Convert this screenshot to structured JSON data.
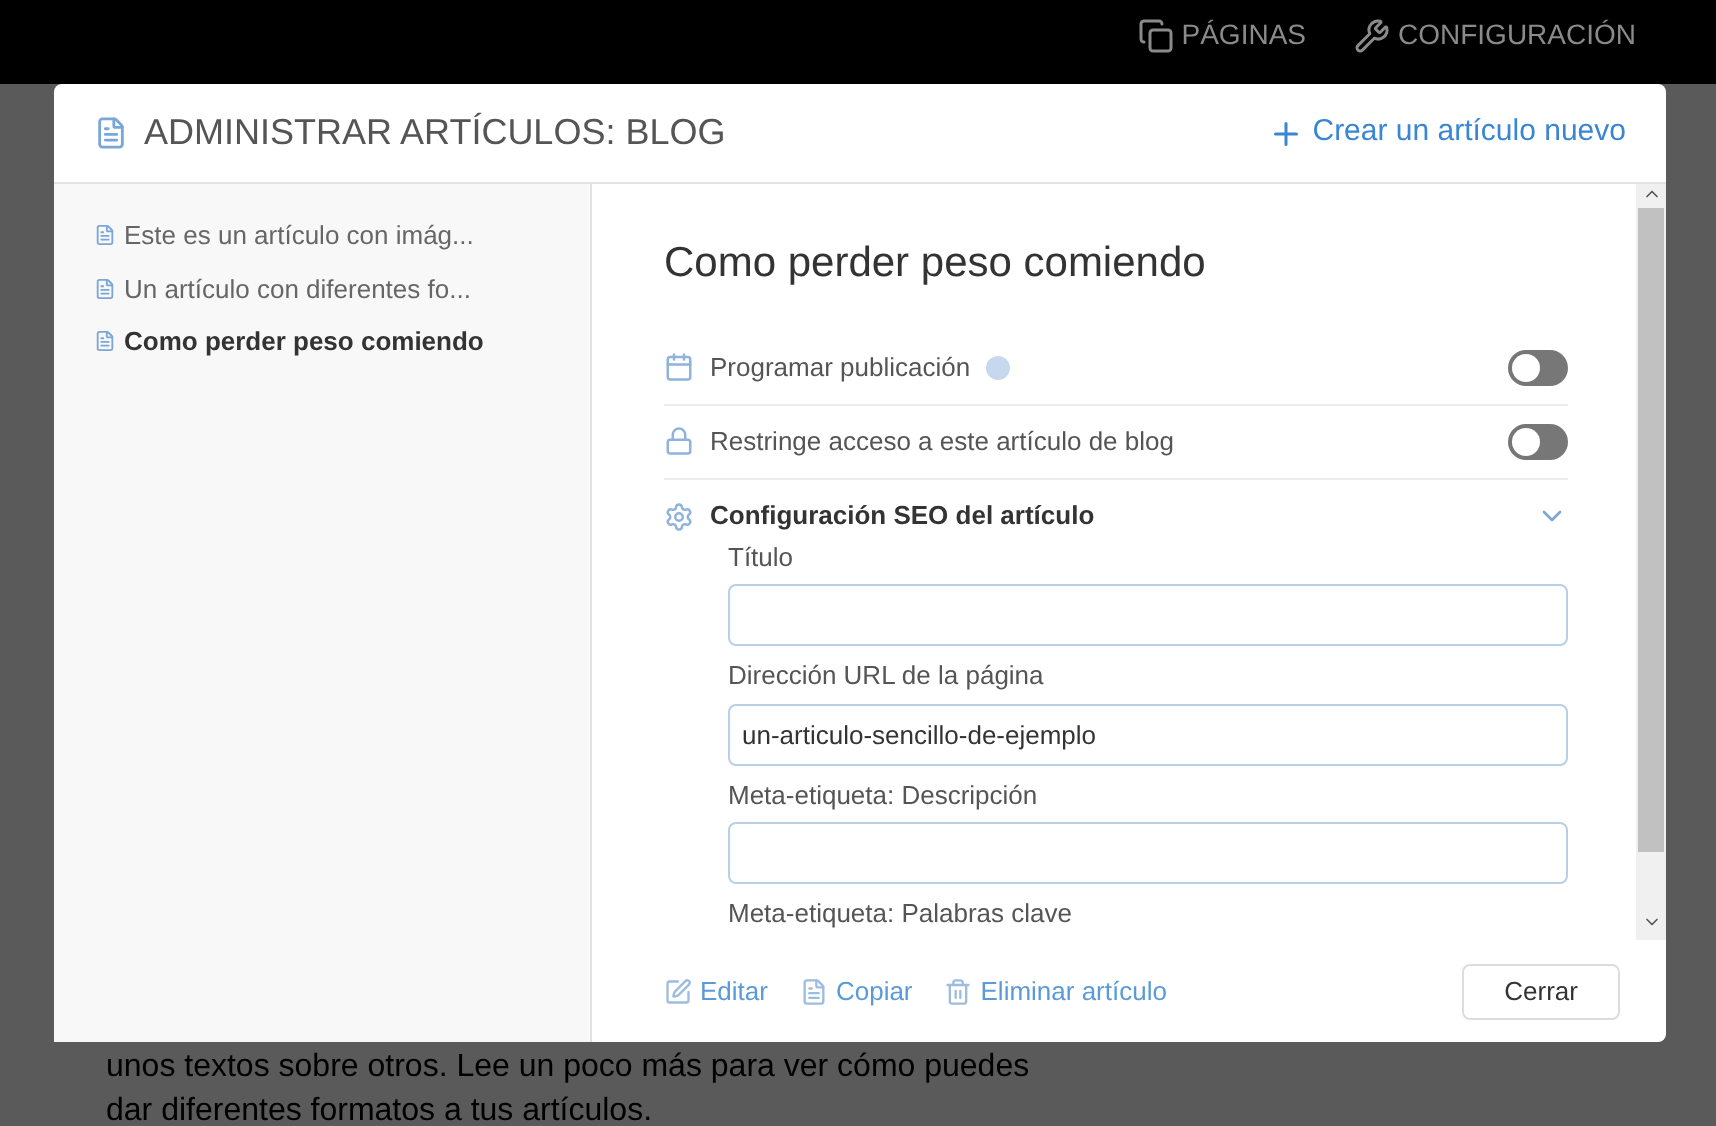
{
  "top_nav": [
    {
      "kind": "pages",
      "label": "PÁGINAS"
    },
    {
      "kind": "settings",
      "label": "CONFIGURACIÓN"
    }
  ],
  "background_text": [
    "unos textos sobre otros. Lee un poco más para ver cómo puedes",
    "dar diferentes formatos a tus artículos."
  ],
  "modal": {
    "title": "ADMINISTRAR ARTÍCULOS: BLOG",
    "create_button": "Crear un artículo nuevo",
    "articles": [
      {
        "title": "Este es un artículo con imág...",
        "selected": false
      },
      {
        "title": "Un artículo con diferentes fo...",
        "selected": false
      },
      {
        "title": "Como perder peso comiendo",
        "selected": true
      }
    ],
    "article_title": "Como perder peso comiendo",
    "settings": [
      {
        "kind": "schedule",
        "label": "Programar publicación",
        "help": true,
        "on": false
      },
      {
        "kind": "lock",
        "label": "Restringe acceso a este artículo de blog",
        "help": false,
        "on": false
      }
    ],
    "seo": {
      "label": "Configuración SEO del artículo",
      "expanded": true,
      "fields": [
        {
          "label": "Título"
        },
        {
          "label": "Dirección URL de la página",
          "value": "un-articulo-sencillo-de-ejemplo"
        },
        {
          "label": "Meta-etiqueta: Descripción"
        },
        {
          "label": "Meta-etiqueta: Palabras clave"
        }
      ]
    },
    "actions": [
      {
        "kind": "edit",
        "label": "Editar"
      },
      {
        "kind": "copy",
        "label": "Copiar"
      },
      {
        "kind": "delete",
        "label": "Eliminar artículo"
      }
    ],
    "close_button": "Cerrar"
  }
}
